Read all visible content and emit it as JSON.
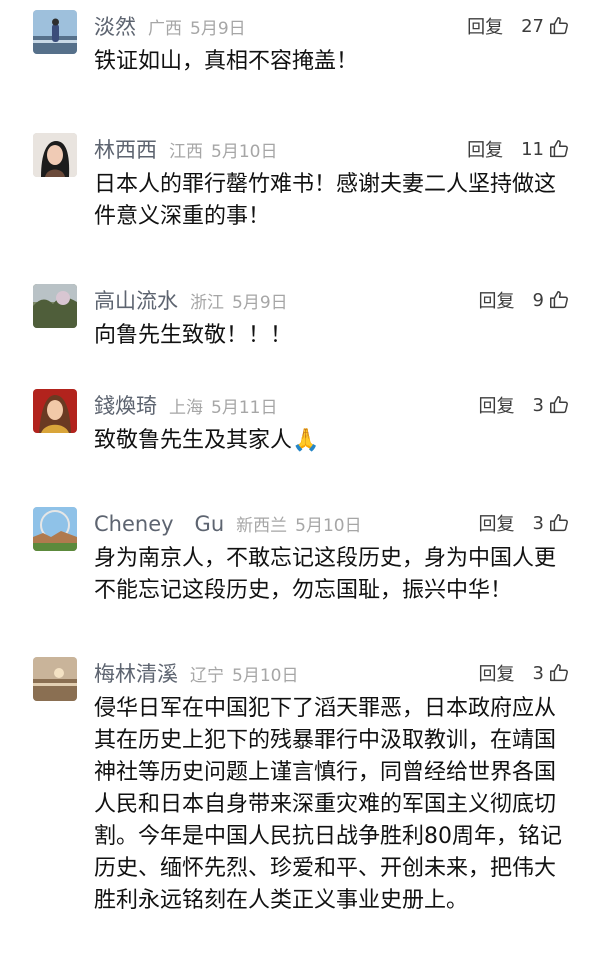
{
  "ui": {
    "reply_label": "回复"
  },
  "comments": [
    {
      "name": "淡然",
      "location": "广西",
      "date": "5月9日",
      "likes": "27",
      "text": "铁证如山，真相不容掩盖！"
    },
    {
      "name": "林西西",
      "location": "江西",
      "date": "5月10日",
      "likes": "11",
      "text": "日本人的罪行罄竹难书！感谢夫妻二人坚持做这件意义深重的事！"
    },
    {
      "name": "高山流水",
      "location": "浙江",
      "date": "5月9日",
      "likes": "9",
      "text": "向鲁先生致敬！！！"
    },
    {
      "name": "錢煥琦",
      "location": "上海",
      "date": "5月11日",
      "likes": "3",
      "text": "致敬鲁先生及其家人🙏"
    },
    {
      "name": "Cheney　Gu",
      "location": "新西兰",
      "date": "5月10日",
      "likes": "3",
      "text": "身为南京人，不敢忘记这段历史，身为中国人更不能忘记这段历史，勿忘国耻，振兴中华！"
    },
    {
      "name": "梅林清溪",
      "location": "辽宁",
      "date": "5月10日",
      "likes": "3",
      "text": "侵华日军在中国犯下了滔天罪恶，日本政府应从其在历史上犯下的残暴罪行中汲取教训，在靖国神社等历史问题上谨言慎行，同曾经给世界各国人民和日本自身带来深重灾难的军国主义彻底切割。今年是中国人民抗日战争胜利80周年，铭记历史、缅怀先烈、珍爱和平、开创未来，把伟大胜利永远铭刻在人类正义事业史册上。"
    }
  ]
}
